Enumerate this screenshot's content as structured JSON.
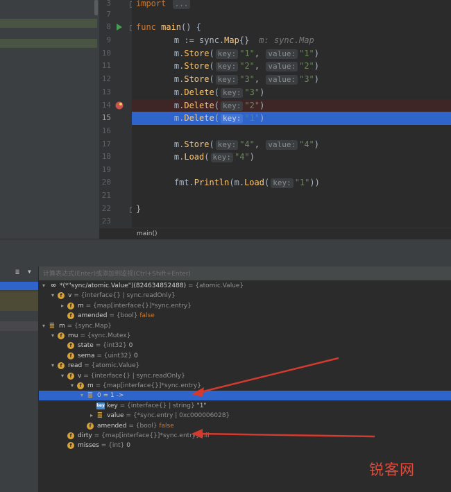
{
  "editor": {
    "breadcrumb": "main()",
    "lines": [
      {
        "no": "3",
        "code": [
          {
            "c": "kw",
            "t": "import "
          },
          {
            "c": "hint",
            "t": "..."
          }
        ]
      },
      {
        "no": "7",
        "code": []
      },
      {
        "no": "8",
        "code": [
          {
            "c": "kw",
            "t": "func "
          },
          {
            "c": "fn",
            "t": "main"
          },
          {
            "c": "",
            "t": "() {"
          }
        ]
      },
      {
        "no": "9",
        "code": [
          {
            "c": "",
            "t": "    m := sync."
          },
          {
            "c": "fn",
            "t": "Map"
          },
          {
            "c": "",
            "t": "{}"
          },
          {
            "c": "ihint",
            "t": "m: sync.Map"
          }
        ]
      },
      {
        "no": "10",
        "code": [
          {
            "c": "",
            "t": "    m."
          },
          {
            "c": "mth",
            "t": "Store"
          },
          {
            "c": "",
            "t": "("
          },
          {
            "c": "hint",
            "t": "key:"
          },
          {
            "c": "str",
            "t": "\"1\""
          },
          {
            "c": "",
            "t": ", "
          },
          {
            "c": "hint",
            "t": "value:"
          },
          {
            "c": "str",
            "t": "\"1\""
          },
          {
            "c": "",
            "t": ")"
          }
        ]
      },
      {
        "no": "11",
        "code": [
          {
            "c": "",
            "t": "    m."
          },
          {
            "c": "mth",
            "t": "Store"
          },
          {
            "c": "",
            "t": "("
          },
          {
            "c": "hint",
            "t": "key:"
          },
          {
            "c": "str",
            "t": "\"2\""
          },
          {
            "c": "",
            "t": ", "
          },
          {
            "c": "hint",
            "t": "value:"
          },
          {
            "c": "str",
            "t": "\"2\""
          },
          {
            "c": "",
            "t": ")"
          }
        ]
      },
      {
        "no": "12",
        "code": [
          {
            "c": "",
            "t": "    m."
          },
          {
            "c": "mth",
            "t": "Store"
          },
          {
            "c": "",
            "t": "("
          },
          {
            "c": "hint",
            "t": "key:"
          },
          {
            "c": "str",
            "t": "\"3\""
          },
          {
            "c": "",
            "t": ", "
          },
          {
            "c": "hint",
            "t": "value:"
          },
          {
            "c": "str",
            "t": "\"3\""
          },
          {
            "c": "",
            "t": ")"
          }
        ]
      },
      {
        "no": "13",
        "code": [
          {
            "c": "",
            "t": "    m."
          },
          {
            "c": "mth",
            "t": "Delete"
          },
          {
            "c": "",
            "t": "("
          },
          {
            "c": "hint",
            "t": "key:"
          },
          {
            "c": "str",
            "t": "\"3\""
          },
          {
            "c": "",
            "t": ")"
          }
        ]
      },
      {
        "no": "14",
        "code": [
          {
            "c": "",
            "t": "    m."
          },
          {
            "c": "mth",
            "t": "Delete"
          },
          {
            "c": "",
            "t": "("
          },
          {
            "c": "hint",
            "t": "key:"
          },
          {
            "c": "str",
            "t": "\"2\""
          },
          {
            "c": "",
            "t": ")"
          }
        ]
      },
      {
        "no": "15",
        "code": [
          {
            "c": "",
            "t": "    m."
          },
          {
            "c": "mth",
            "t": "Delete"
          },
          {
            "c": "",
            "t": "("
          },
          {
            "c": "hint",
            "t": "key:"
          },
          {
            "c": "str",
            "t": "\"1\""
          },
          {
            "c": "",
            "t": ")"
          }
        ]
      },
      {
        "no": "16",
        "code": []
      },
      {
        "no": "17",
        "code": [
          {
            "c": "",
            "t": "    m."
          },
          {
            "c": "mth",
            "t": "Store"
          },
          {
            "c": "",
            "t": "("
          },
          {
            "c": "hint",
            "t": "key:"
          },
          {
            "c": "str",
            "t": "\"4\""
          },
          {
            "c": "",
            "t": ", "
          },
          {
            "c": "hint",
            "t": "value:"
          },
          {
            "c": "str",
            "t": "\"4\""
          },
          {
            "c": "",
            "t": ")"
          }
        ]
      },
      {
        "no": "18",
        "code": [
          {
            "c": "",
            "t": "    m."
          },
          {
            "c": "mth",
            "t": "Load"
          },
          {
            "c": "",
            "t": "("
          },
          {
            "c": "hint",
            "t": "key:"
          },
          {
            "c": "str",
            "t": "\"4\""
          },
          {
            "c": "",
            "t": ")"
          }
        ]
      },
      {
        "no": "19",
        "code": []
      },
      {
        "no": "20",
        "code": [
          {
            "c": "",
            "t": "    fmt."
          },
          {
            "c": "mth",
            "t": "Println"
          },
          {
            "c": "",
            "t": "(m."
          },
          {
            "c": "mth",
            "t": "Load"
          },
          {
            "c": "",
            "t": "("
          },
          {
            "c": "hint",
            "t": "key:"
          },
          {
            "c": "str",
            "t": "\"1\""
          },
          {
            "c": "",
            "t": "))"
          }
        ]
      },
      {
        "no": "21",
        "code": []
      },
      {
        "no": "22",
        "code": [
          {
            "c": "",
            "t": "}"
          }
        ]
      },
      {
        "no": "23",
        "code": []
      }
    ]
  },
  "debugger": {
    "eval_placeholder": "计算表达式(Enter)或添加到监视(Ctrl+Shift+Enter)",
    "rows": [
      {
        "icon": "glasses",
        "name": "*(*\"sync/atomic.Value\")(824634852488)",
        "type": "= {atomic.Value}",
        "value": "",
        "vc": ""
      },
      {
        "icon": "f",
        "name": "v",
        "type": "= {interface{} | sync.readOnly}",
        "value": "",
        "vc": ""
      },
      {
        "icon": "f",
        "name": "m",
        "type": "= {map[interface{}]*sync.entry}",
        "value": "",
        "vc": ""
      },
      {
        "icon": "f",
        "name": "amended",
        "type": "= {bool}",
        "value": "false",
        "vc": "vl-o"
      },
      {
        "icon": "list",
        "name": "m",
        "type": "= {sync.Map}",
        "value": "",
        "vc": ""
      },
      {
        "icon": "f",
        "name": "mu",
        "type": "= {sync.Mutex}",
        "value": "",
        "vc": ""
      },
      {
        "icon": "f",
        "name": "state",
        "type": "= {int32}",
        "value": "0",
        "vc": ""
      },
      {
        "icon": "f",
        "name": "sema",
        "type": "= {uint32}",
        "value": "0",
        "vc": ""
      },
      {
        "icon": "f",
        "name": "read",
        "type": "= {atomic.Value}",
        "value": "",
        "vc": ""
      },
      {
        "icon": "f",
        "name": "v",
        "type": "= {interface{} | sync.readOnly}",
        "value": "",
        "vc": ""
      },
      {
        "icon": "f",
        "name": "m",
        "type": "= {map[interface{}]*sync.entry}",
        "value": "",
        "vc": ""
      },
      {
        "icon": "list",
        "name": "0 = 1 ->",
        "type": "",
        "value": "",
        "vc": ""
      },
      {
        "icon": "key",
        "name": "key",
        "type": "= {interface{} | string}",
        "value": "\"1\"",
        "vc": ""
      },
      {
        "icon": "list",
        "name": "value",
        "type": "= {*sync.entry | 0xc000006028}",
        "value": "",
        "vc": ""
      },
      {
        "icon": "f",
        "name": "amended",
        "type": "= {bool}",
        "value": "false",
        "vc": "vl-o"
      },
      {
        "icon": "f",
        "name": "dirty",
        "type": "= {map[interface{}]*sync.entry}",
        "value": "nil",
        "vc": "vl-r"
      },
      {
        "icon": "f",
        "name": "misses",
        "type": "= {int}",
        "value": "0",
        "vc": ""
      }
    ]
  },
  "watermark": "锐客网",
  "colors": {
    "selection": "#2f65ca",
    "breakpoint": "#c9534a",
    "arrow": "#d43a2d"
  }
}
